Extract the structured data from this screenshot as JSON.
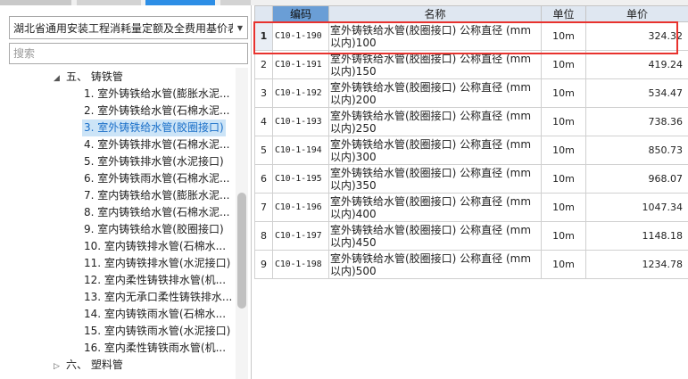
{
  "left_panel": {
    "library_select": "湖北省通用安装工程消耗量定额及全费用基价表",
    "search_placeholder": "搜索",
    "tree": [
      {
        "label": "五、 铸铁管",
        "expanded": true
      },
      {
        "label": "1. 室外铸铁给水管(膨胀水泥..."
      },
      {
        "label": "2. 室外铸铁给水管(石棉水泥..."
      },
      {
        "label": "3. 室外铸铁给水管(胶圈接口)",
        "selected": true
      },
      {
        "label": "4. 室外铸铁排水管(石棉水泥..."
      },
      {
        "label": "5. 室外铸铁排水管(水泥接口)"
      },
      {
        "label": "6. 室外铸铁雨水管(石棉水泥..."
      },
      {
        "label": "7. 室内铸铁给水管(膨胀水泥..."
      },
      {
        "label": "8. 室内铸铁给水管(石棉水泥..."
      },
      {
        "label": "9. 室内铸铁给水管(胶圈接口)"
      },
      {
        "label": "10. 室内铸铁排水管(石棉水..."
      },
      {
        "label": "11. 室内铸铁排水管(水泥接口)"
      },
      {
        "label": "12. 室内柔性铸铁排水管(机..."
      },
      {
        "label": "13. 室内无承口柔性铸铁排水..."
      },
      {
        "label": "14. 室内铸铁雨水管(石棉水..."
      },
      {
        "label": "15. 室内铸铁雨水管(水泥接口)"
      },
      {
        "label": "16. 室内柔性铸铁雨水管(机..."
      },
      {
        "label": "六、 塑料管",
        "expanded": false
      }
    ]
  },
  "grid": {
    "headers": {
      "num": "",
      "code": "编码",
      "name": "名称",
      "unit": "单位",
      "price": "单价"
    },
    "rows": [
      {
        "num": "1",
        "code": "C10-1-190",
        "name": "室外铸铁给水管(胶圈接口) 公称直径 (mm以内)100",
        "unit": "10m",
        "price": "324.32"
      },
      {
        "num": "2",
        "code": "C10-1-191",
        "name": "室外铸铁给水管(胶圈接口) 公称直径 (mm以内)150",
        "unit": "10m",
        "price": "419.24"
      },
      {
        "num": "3",
        "code": "C10-1-192",
        "name": "室外铸铁给水管(胶圈接口) 公称直径 (mm以内)200",
        "unit": "10m",
        "price": "534.47"
      },
      {
        "num": "4",
        "code": "C10-1-193",
        "name": "室外铸铁给水管(胶圈接口) 公称直径 (mm以内)250",
        "unit": "10m",
        "price": "738.36"
      },
      {
        "num": "5",
        "code": "C10-1-194",
        "name": "室外铸铁给水管(胶圈接口) 公称直径 (mm以内)300",
        "unit": "10m",
        "price": "850.73"
      },
      {
        "num": "6",
        "code": "C10-1-195",
        "name": "室外铸铁给水管(胶圈接口) 公称直径 (mm以内)350",
        "unit": "10m",
        "price": "968.07"
      },
      {
        "num": "7",
        "code": "C10-1-196",
        "name": "室外铸铁给水管(胶圈接口) 公称直径 (mm以内)400",
        "unit": "10m",
        "price": "1047.34"
      },
      {
        "num": "8",
        "code": "C10-1-197",
        "name": "室外铸铁给水管(胶圈接口) 公称直径 (mm以内)450",
        "unit": "10m",
        "price": "1148.18"
      },
      {
        "num": "9",
        "code": "C10-1-198",
        "name": "室外铸铁给水管(胶圈接口) 公称直径 (mm以内)500",
        "unit": "10m",
        "price": "1234.78"
      }
    ]
  },
  "colors": {
    "highlight": "#e8322e",
    "selected_text": "#1a6fc9",
    "selected_bg": "#cce4f7",
    "header_accent": "#6a9ed6"
  }
}
